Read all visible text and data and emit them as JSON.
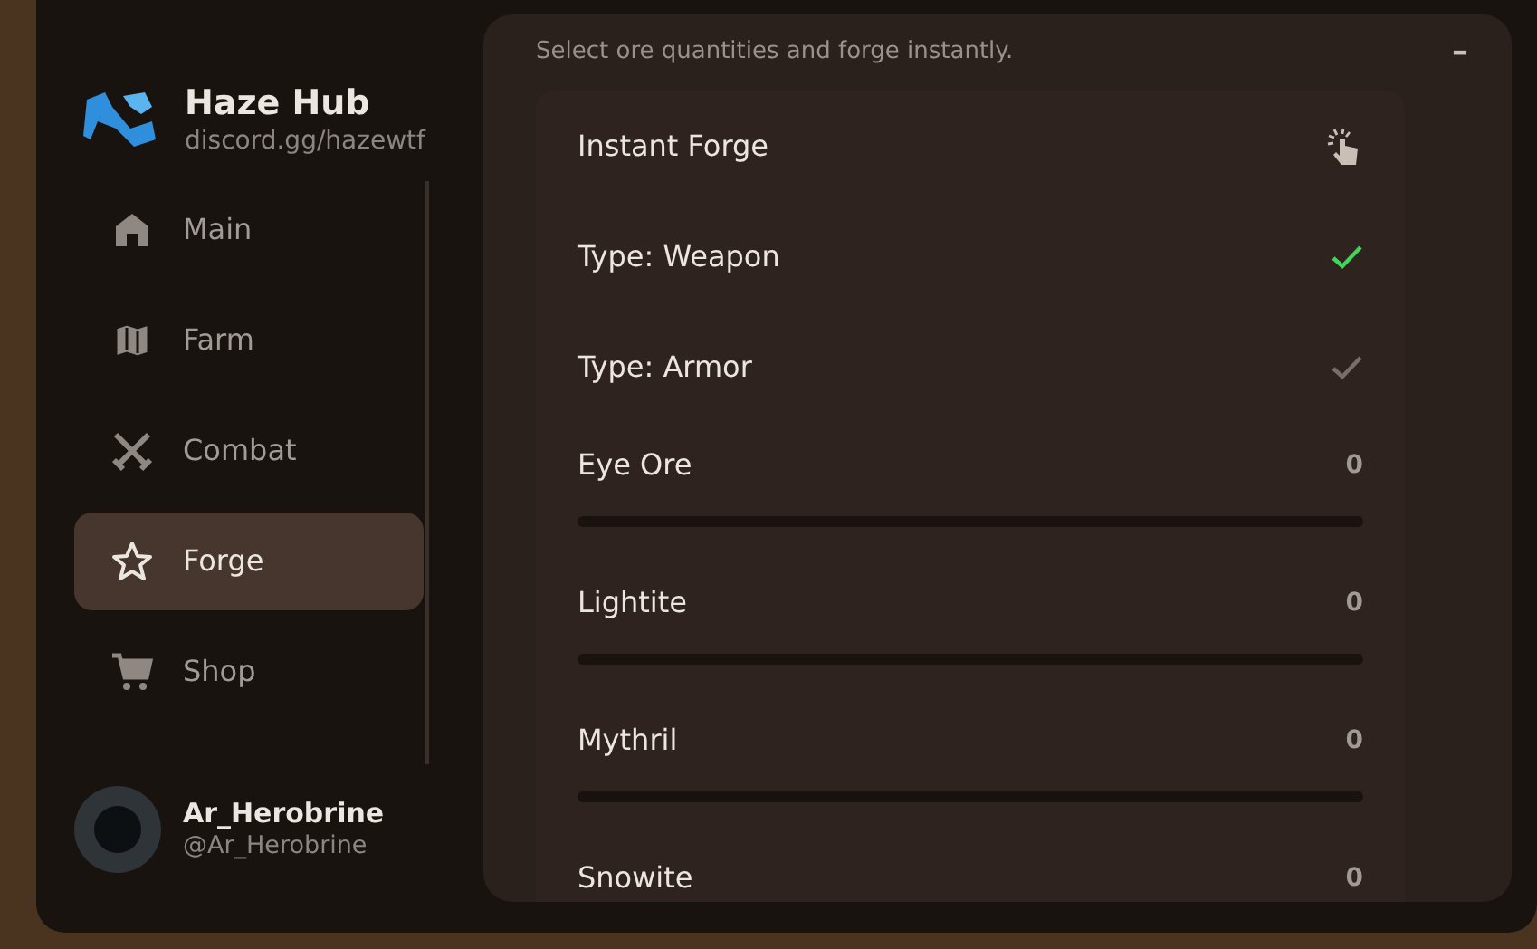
{
  "brand": {
    "title": "Haze Hub",
    "subtitle": "discord.gg/hazewtf"
  },
  "sidebar": {
    "items": [
      {
        "label": "Main",
        "selected": false
      },
      {
        "label": "Farm",
        "selected": false
      },
      {
        "label": "Combat",
        "selected": false
      },
      {
        "label": "Forge",
        "selected": true
      },
      {
        "label": "Shop",
        "selected": false
      }
    ]
  },
  "profile": {
    "name": "Ar_Herobrine",
    "handle": "@Ar_Herobrine"
  },
  "panel": {
    "description": "Select ore quantities and forge instantly.",
    "minimize": "–"
  },
  "rows": [
    {
      "kind": "button",
      "label": "Instant Forge"
    },
    {
      "kind": "toggle",
      "label": "Type: Weapon",
      "checked": true
    },
    {
      "kind": "toggle",
      "label": "Type: Armor",
      "checked": false
    },
    {
      "kind": "slider",
      "label": "Eye Ore",
      "reading": "0",
      "level": 0
    },
    {
      "kind": "slider",
      "label": "Lightite",
      "reading": "0",
      "level": 0
    },
    {
      "kind": "slider",
      "label": "Mythril",
      "reading": "0",
      "level": 0
    },
    {
      "kind": "slider",
      "label": "Snowite",
      "reading": "0"
    }
  ]
}
